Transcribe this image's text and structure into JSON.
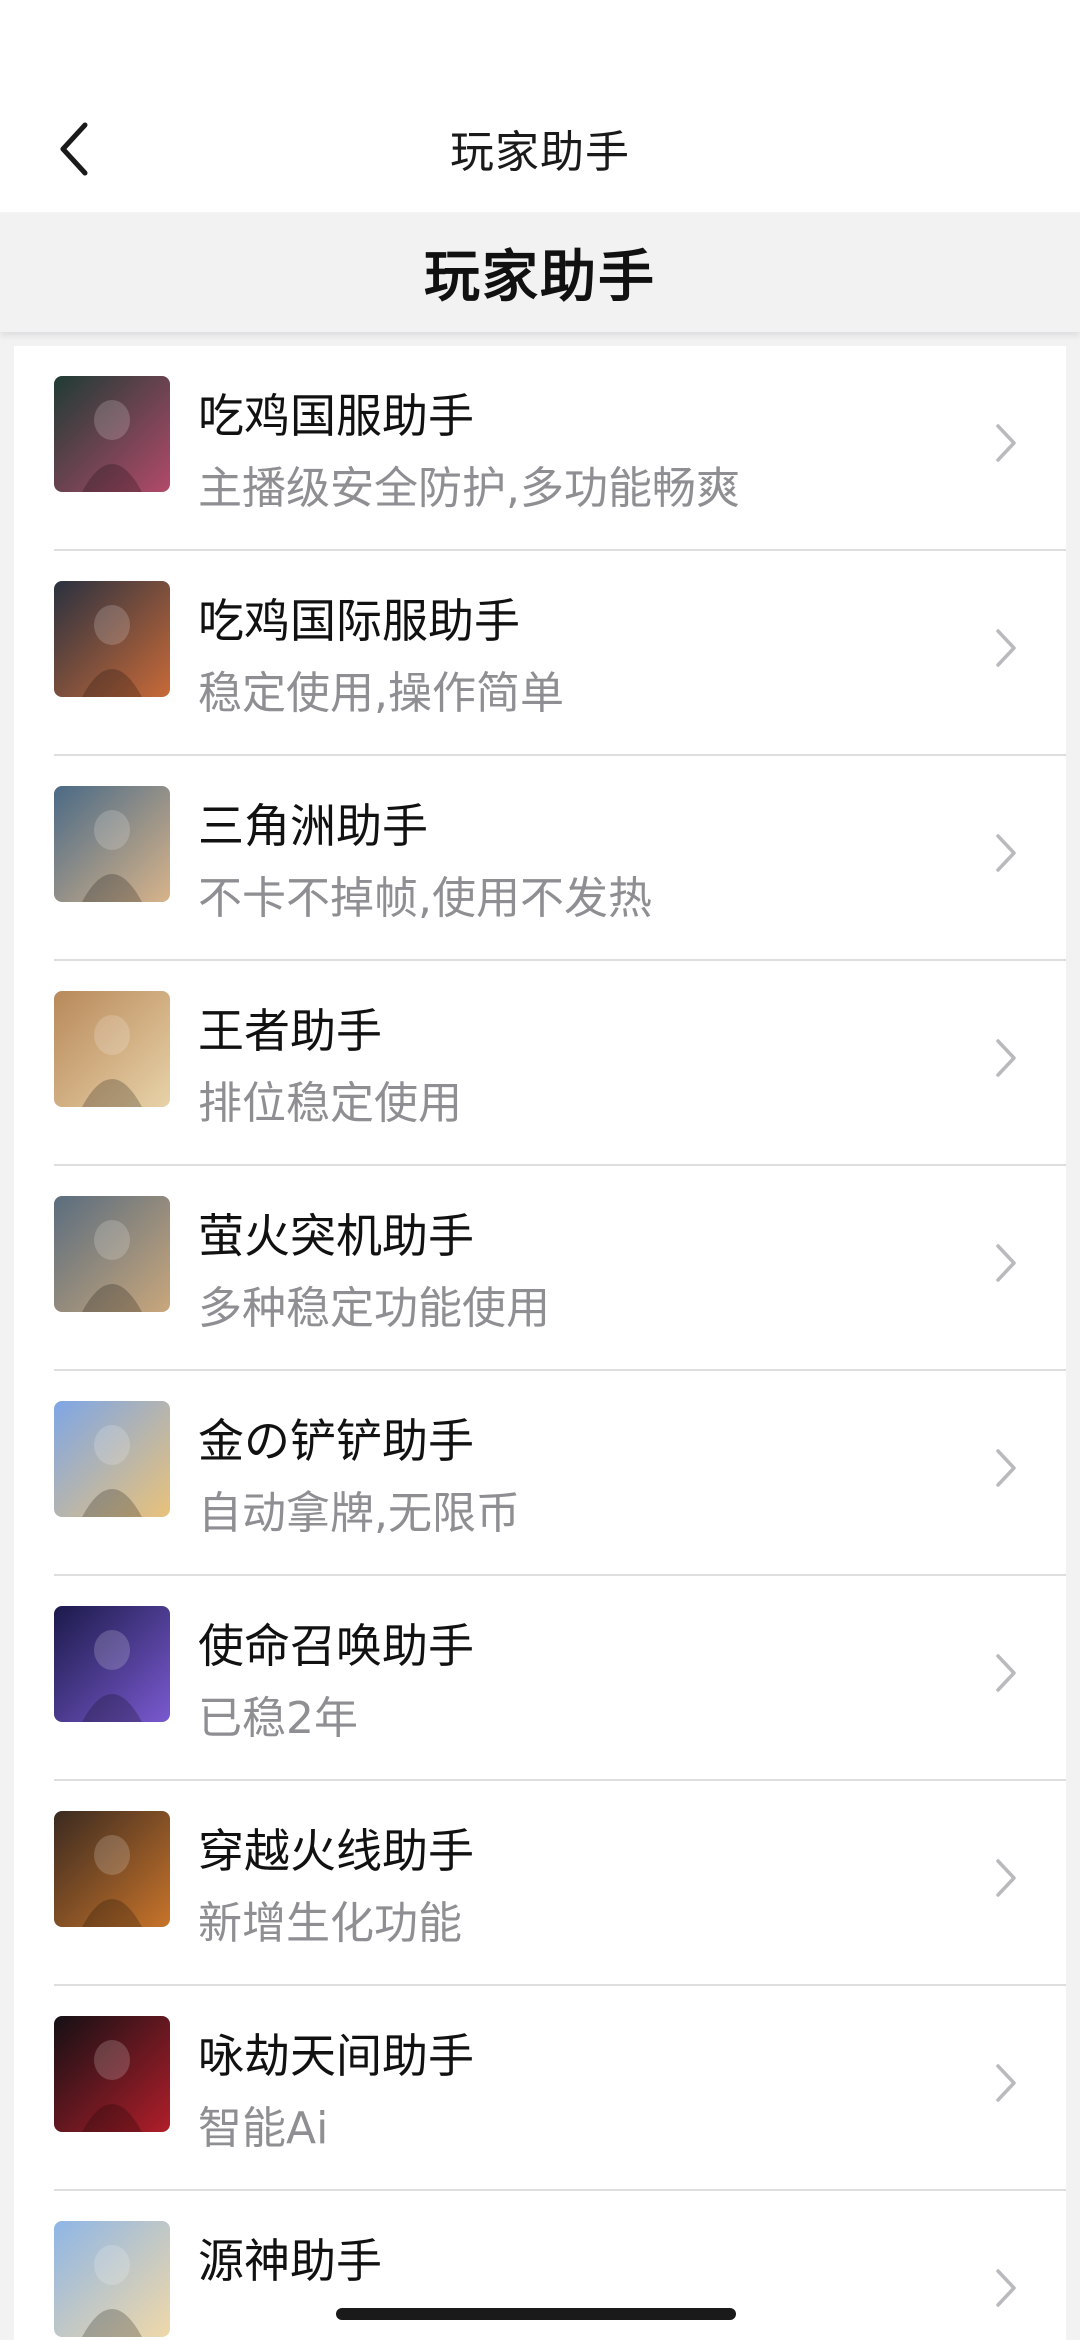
{
  "nav": {
    "title": "玩家助手",
    "back_icon": "chevron-left-icon"
  },
  "header": {
    "title": "玩家助手"
  },
  "items": [
    {
      "title": "吃鸡国服助手",
      "subtitle": "主播级安全防护,多功能畅爽",
      "thumb_colors": [
        "#1f3b34",
        "#b24a6a"
      ]
    },
    {
      "title": "吃鸡国际服助手",
      "subtitle": "稳定使用,操作简单",
      "thumb_colors": [
        "#2a3140",
        "#c86a38"
      ]
    },
    {
      "title": "三角洲助手",
      "subtitle": "不卡不掉帧,使用不发热",
      "thumb_colors": [
        "#4a6a86",
        "#d8b48a"
      ]
    },
    {
      "title": "王者助手",
      "subtitle": "排位稳定使用",
      "thumb_colors": [
        "#b8895a",
        "#e8d2a8"
      ]
    },
    {
      "title": "萤火突机助手",
      "subtitle": "多种稳定功能使用",
      "thumb_colors": [
        "#5a6d7e",
        "#c9a77c"
      ]
    },
    {
      "title": "金の铲铲助手",
      "subtitle": "自动拿牌,无限币",
      "thumb_colors": [
        "#7ea6e6",
        "#e9c27a"
      ]
    },
    {
      "title": "使命召唤助手",
      "subtitle": "已稳2年",
      "thumb_colors": [
        "#1b1a4a",
        "#7a5ad0"
      ]
    },
    {
      "title": "穿越火线助手",
      "subtitle": "新增生化功能",
      "thumb_colors": [
        "#3a2a20",
        "#c8742a"
      ]
    },
    {
      "title": "咏劫天间助手",
      "subtitle": "智能Ai",
      "thumb_colors": [
        "#141014",
        "#b01e2a"
      ]
    },
    {
      "title": "源神助手",
      "subtitle": "",
      "thumb_colors": [
        "#8eb6e6",
        "#f0d8a8"
      ]
    }
  ],
  "chevron_icon": "chevron-right-icon",
  "colors": {
    "title_text": "#111111",
    "subtitle_text": "#8e8e93",
    "divider": "#dedede",
    "background": "#f2f2f3"
  }
}
